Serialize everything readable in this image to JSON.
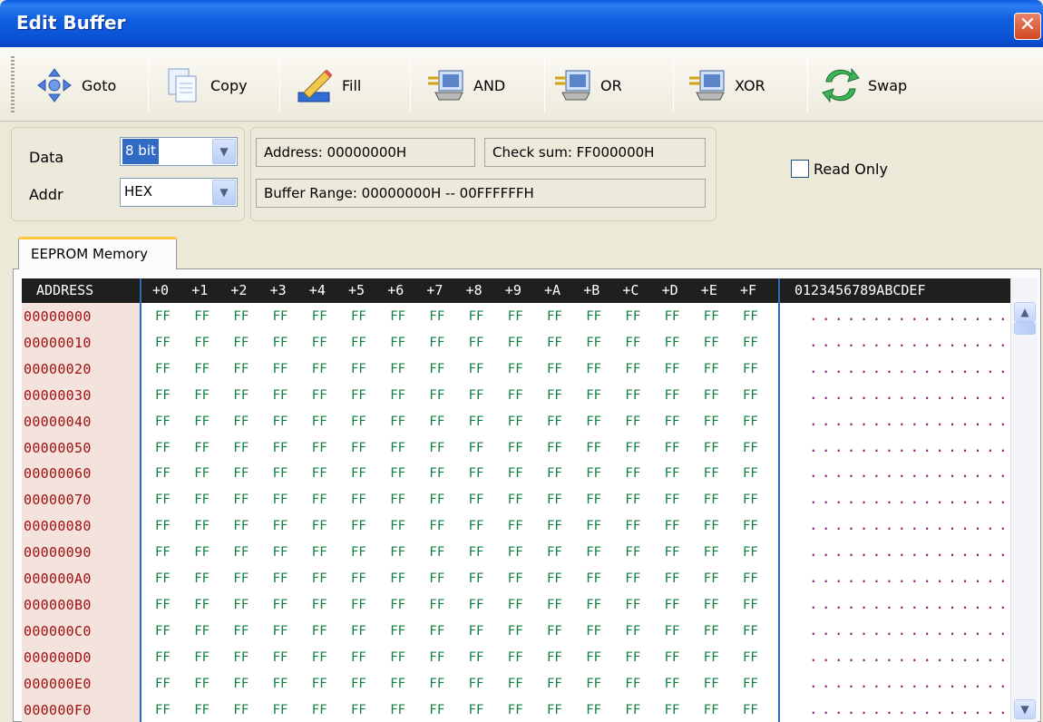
{
  "window": {
    "title": "Edit Buffer",
    "close_glyph": "✕"
  },
  "toolbar": {
    "buttons": [
      {
        "label": "Goto",
        "icon": "goto-arrows-icon"
      },
      {
        "label": "Copy",
        "icon": "copy-pages-icon"
      },
      {
        "label": "Fill",
        "icon": "fill-pencil-icon"
      },
      {
        "label": "AND",
        "icon": "and-chip-icon"
      },
      {
        "label": "OR",
        "icon": "or-chip-icon"
      },
      {
        "label": "XOR",
        "icon": "xor-chip-icon"
      },
      {
        "label": "Swap",
        "icon": "swap-arrows-icon"
      }
    ]
  },
  "options": {
    "data_label": "Data",
    "data_value": "8 bit",
    "addr_label": "Addr",
    "addr_value": "HEX",
    "address": "Address: 00000000H",
    "checksum": "Check sum: FF000000H",
    "buffer_range": "Buffer Range: 00000000H -- 00FFFFFFH",
    "read_only_label": "Read Only",
    "read_only_checked": false
  },
  "tabs": [
    {
      "label": "EEPROM Memory",
      "active": true
    }
  ],
  "grid": {
    "address_header": "ADDRESS",
    "offset_headers": [
      "+0",
      "+1",
      "+2",
      "+3",
      "+4",
      "+5",
      "+6",
      "+7",
      "+8",
      "+9",
      "+A",
      "+B",
      "+C",
      "+D",
      "+E",
      "+F"
    ],
    "ascii_header": "0123456789ABCDEF",
    "rows": [
      {
        "address": "00000000",
        "ascii": "................"
      },
      {
        "address": "00000010",
        "ascii": "................"
      },
      {
        "address": "00000020",
        "ascii": "................"
      },
      {
        "address": "00000030",
        "ascii": "................"
      },
      {
        "address": "00000040",
        "ascii": "................"
      },
      {
        "address": "00000050",
        "ascii": "................"
      },
      {
        "address": "00000060",
        "ascii": "................"
      },
      {
        "address": "00000070",
        "ascii": "................"
      },
      {
        "address": "00000080",
        "ascii": "................"
      },
      {
        "address": "00000090",
        "ascii": "................"
      },
      {
        "address": "000000A0",
        "ascii": "................"
      },
      {
        "address": "000000B0",
        "ascii": "................"
      },
      {
        "address": "000000C0",
        "ascii": "................"
      },
      {
        "address": "000000D0",
        "ascii": "................"
      },
      {
        "address": "000000E0",
        "ascii": "................"
      },
      {
        "address": "000000F0",
        "ascii": "................"
      }
    ],
    "byte_value": "FF"
  },
  "colors": {
    "address_text": "#A01010",
    "byte_text": "#0F7F3F",
    "ascii_text": "#8B1A6A",
    "header_bg": "#1F1F1F",
    "title_bar": "#0A52D6"
  }
}
